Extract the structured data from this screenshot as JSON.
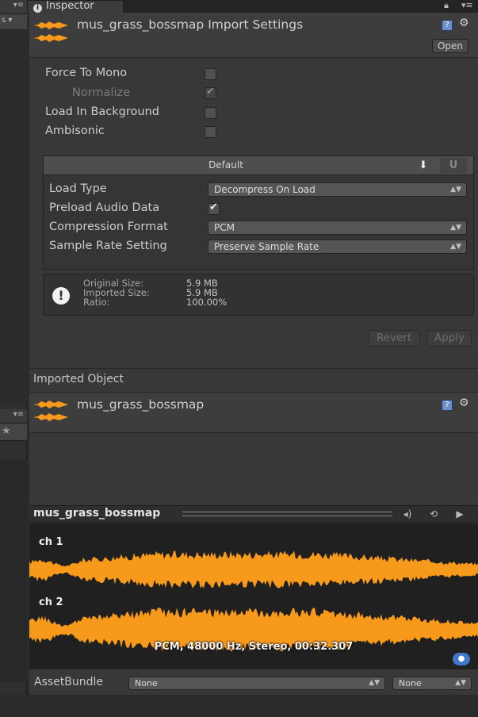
{
  "tab": {
    "title": "Inspector",
    "icon": "info-icon",
    "lock": "lock-icon",
    "menu": "menu-icon"
  },
  "header": {
    "title": "mus_grass_bossmap Import Settings",
    "open_label": "Open",
    "help_icon": "help-icon",
    "gear_icon": "gear-icon"
  },
  "options": [
    {
      "label": "Force To Mono",
      "checked": false,
      "disabled": false
    },
    {
      "label": "Normalize",
      "checked": true,
      "disabled": true
    },
    {
      "label": "Load In Background",
      "checked": false,
      "disabled": false
    },
    {
      "label": "Ambisonic",
      "checked": false,
      "disabled": false
    }
  ],
  "platform": {
    "default_tab": "Default",
    "download_icon": "download-icon",
    "webgl_icon": "unity-platform-icon",
    "load_type": {
      "label": "Load Type",
      "value": "Decompress On Load"
    },
    "preload": {
      "label": "Preload Audio Data",
      "checked": true
    },
    "compression": {
      "label": "Compression Format",
      "value": "PCM"
    },
    "sample_rate": {
      "label": "Sample Rate Setting",
      "value": "Preserve Sample Rate"
    }
  },
  "info": {
    "original_label": "Original Size:",
    "original_value": "5.9 MB",
    "imported_label": "Imported Size:",
    "imported_value": "5.9 MB",
    "ratio_label": "Ratio:",
    "ratio_value": "100.00%"
  },
  "buttons": {
    "revert": "Revert",
    "apply": "Apply"
  },
  "imported": {
    "section_label": "Imported Object",
    "name": "mus_grass_bossmap"
  },
  "preview": {
    "title": "mus_grass_bossmap",
    "ch1": "ch 1",
    "ch2": "ch 2",
    "format": "PCM, 48000 Hz, Stereo, 00:32.307",
    "waveform_color": "#f79a1c"
  },
  "assetbundle": {
    "label": "AssetBundle",
    "name_value": "None",
    "variant_value": "None"
  },
  "colors": {
    "accent_orange": "#f79a1c",
    "panel": "#383838"
  }
}
